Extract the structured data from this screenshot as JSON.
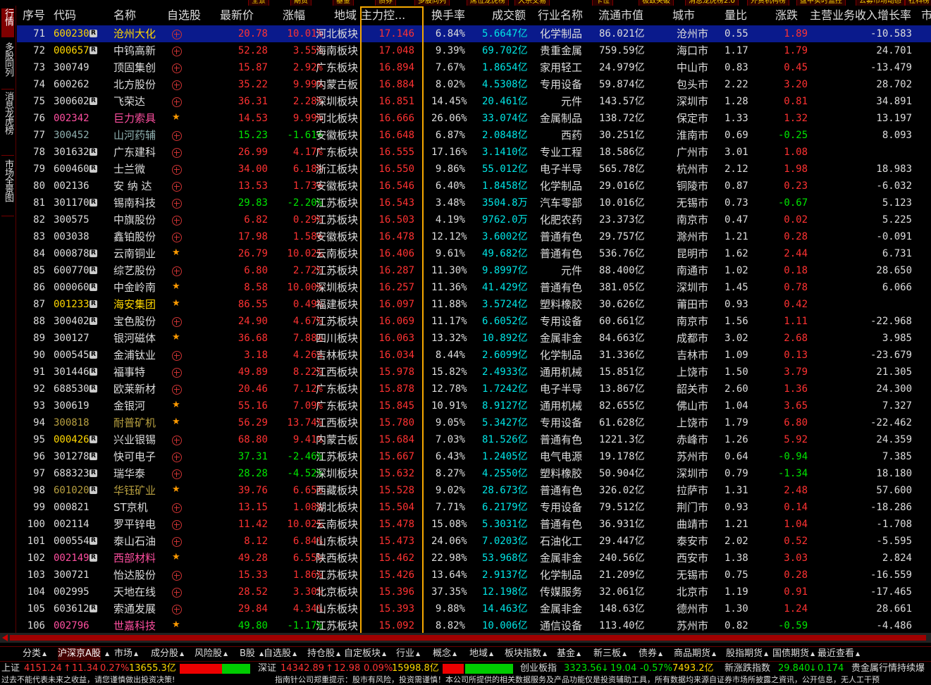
{
  "top_tabs": [
    "全景",
    "期货",
    "基金",
    "债券",
    "多股同列",
    "席位龙虎榜",
    "大宗交易",
    "卡位",
    "极致突破",
    "消息龙虎榜2.0",
    "外资机构榜",
    "盘中实时监控",
    "公募市场动态",
    "社科榜"
  ],
  "sidebar": [
    "行情",
    "多股同列",
    "消息龙虎榜2.0",
    "市场全景图"
  ],
  "columns": [
    "序号",
    "代码",
    "名称",
    "自选股",
    "最新价",
    "涨幅",
    "地域",
    "主力控...",
    "换手率",
    "成交额",
    "行业名称",
    "流通市值",
    "城市",
    "量比",
    "涨跌",
    "主营业务收入增长率",
    "市"
  ],
  "rows": [
    {
      "no": "71",
      "code": "600230",
      "name": "沧州大化",
      "r": true,
      "star": false,
      "price": "20.78",
      "pct": "10.01%",
      "region": "河北板块",
      "ctrl": "17.146",
      "turn": "6.84%",
      "amt": "5.6647亿",
      "ind": "化学制品",
      "mcap": "86.021亿",
      "city": "沧州市",
      "vr": "0.55",
      "chg": "1.89",
      "growth": "-10.583",
      "sel": true,
      "cc": "y",
      "nc": "y",
      "dir": "r"
    },
    {
      "no": "72",
      "code": "000657",
      "name": "中钨高新",
      "r": true,
      "star": false,
      "price": "52.28",
      "pct": "3.55%",
      "region": "海南板块",
      "ctrl": "17.048",
      "turn": "9.39%",
      "amt": "69.702亿",
      "ind": "贵重金属",
      "mcap": "759.59亿",
      "city": "海口市",
      "vr": "1.17",
      "chg": "1.79",
      "growth": "24.701",
      "cc": "y",
      "nc": "w",
      "dir": "r"
    },
    {
      "no": "73",
      "code": "300749",
      "name": "顶固集创",
      "r": false,
      "star": false,
      "price": "15.87",
      "pct": "2.92%",
      "region": "广东板块",
      "ctrl": "16.894",
      "turn": "7.67%",
      "amt": "1.8654亿",
      "ind": "家用轻工",
      "mcap": "24.979亿",
      "city": "中山市",
      "vr": "0.83",
      "chg": "0.45",
      "growth": "-13.479",
      "cc": "w",
      "nc": "w",
      "dir": "r"
    },
    {
      "no": "74",
      "code": "600262",
      "name": "北方股份",
      "r": false,
      "star": false,
      "price": "35.22",
      "pct": "9.99%",
      "region": "内蒙古板",
      "ctrl": "16.884",
      "turn": "8.02%",
      "amt": "4.5308亿",
      "ind": "专用设备",
      "mcap": "59.874亿",
      "city": "包头市",
      "vr": "2.22",
      "chg": "3.20",
      "growth": "28.702",
      "cc": "w",
      "nc": "w",
      "dir": "r"
    },
    {
      "no": "75",
      "code": "300602",
      "name": "飞荣达",
      "r": true,
      "star": false,
      "price": "36.31",
      "pct": "2.28%",
      "region": "深圳板块",
      "ctrl": "16.851",
      "turn": "14.45%",
      "amt": "20.461亿",
      "ind": "元件",
      "mcap": "143.57亿",
      "city": "深圳市",
      "vr": "1.28",
      "chg": "0.81",
      "growth": "34.891",
      "cc": "w",
      "nc": "w",
      "dir": "r"
    },
    {
      "no": "76",
      "code": "002342",
      "name": "巨力索具",
      "r": false,
      "star": true,
      "price": "14.53",
      "pct": "9.99%",
      "region": "河北板块",
      "ctrl": "16.666",
      "turn": "26.06%",
      "amt": "33.074亿",
      "ind": "金属制品",
      "mcap": "138.72亿",
      "city": "保定市",
      "vr": "1.33",
      "chg": "1.32",
      "growth": "13.197",
      "cc": "m",
      "nc": "m",
      "dir": "r"
    },
    {
      "no": "77",
      "code": "300452",
      "name": "山河药辅",
      "r": false,
      "star": false,
      "price": "15.23",
      "pct": "-1.61%",
      "region": "安徽板块",
      "ctrl": "16.648",
      "turn": "6.87%",
      "amt": "2.0848亿",
      "ind": "西药",
      "mcap": "30.251亿",
      "city": "淮南市",
      "vr": "0.69",
      "chg": "-0.25",
      "growth": "8.093",
      "cc": "gr",
      "nc": "gr",
      "dir": "g"
    },
    {
      "no": "78",
      "code": "301632",
      "name": "广东建科",
      "r": true,
      "star": false,
      "price": "26.99",
      "pct": "4.17%",
      "region": "广东板块",
      "ctrl": "16.555",
      "turn": "17.16%",
      "amt": "3.1410亿",
      "ind": "专业工程",
      "mcap": "18.586亿",
      "city": "广州市",
      "vr": "3.01",
      "chg": "1.08",
      "growth": "",
      "cc": "w",
      "nc": "w",
      "dir": "r"
    },
    {
      "no": "79",
      "code": "600460",
      "name": "士兰微",
      "r": true,
      "star": false,
      "price": "34.00",
      "pct": "6.18%",
      "region": "浙江板块",
      "ctrl": "16.550",
      "turn": "9.86%",
      "amt": "55.012亿",
      "ind": "电子半导",
      "mcap": "565.78亿",
      "city": "杭州市",
      "vr": "2.12",
      "chg": "1.98",
      "growth": "18.983",
      "cc": "w",
      "nc": "w",
      "dir": "r"
    },
    {
      "no": "80",
      "code": "002136",
      "name": "安 纳 达",
      "r": false,
      "star": false,
      "price": "13.53",
      "pct": "1.73%",
      "region": "安徽板块",
      "ctrl": "16.546",
      "turn": "6.40%",
      "amt": "1.8458亿",
      "ind": "化学制品",
      "mcap": "29.016亿",
      "city": "铜陵市",
      "vr": "0.87",
      "chg": "0.23",
      "growth": "-6.032",
      "cc": "w",
      "nc": "w",
      "dir": "r"
    },
    {
      "no": "81",
      "code": "301170",
      "name": "锡南科技",
      "r": true,
      "star": false,
      "price": "29.83",
      "pct": "-2.20%",
      "region": "江苏板块",
      "ctrl": "16.543",
      "turn": "3.48%",
      "amt": "3504.8万",
      "ind": "汽车零部",
      "mcap": "10.016亿",
      "city": "无锡市",
      "vr": "0.73",
      "chg": "-0.67",
      "growth": "5.123",
      "cc": "w",
      "nc": "w",
      "dir": "g"
    },
    {
      "no": "82",
      "code": "300575",
      "name": "中旗股份",
      "r": false,
      "star": false,
      "price": "6.82",
      "pct": "0.29%",
      "region": "江苏板块",
      "ctrl": "16.503",
      "turn": "4.19%",
      "amt": "9762.0万",
      "ind": "化肥农药",
      "mcap": "23.373亿",
      "city": "南京市",
      "vr": "0.47",
      "chg": "0.02",
      "growth": "5.225",
      "cc": "w",
      "nc": "w",
      "dir": "r"
    },
    {
      "no": "83",
      "code": "003038",
      "name": "鑫铂股份",
      "r": false,
      "star": false,
      "price": "17.98",
      "pct": "1.58%",
      "region": "安徽板块",
      "ctrl": "16.478",
      "turn": "12.12%",
      "amt": "3.6002亿",
      "ind": "普通有色",
      "mcap": "29.757亿",
      "city": "滁州市",
      "vr": "1.21",
      "chg": "0.28",
      "growth": "-0.091",
      "cc": "w",
      "nc": "w",
      "dir": "r"
    },
    {
      "no": "84",
      "code": "000878",
      "name": "云南铜业",
      "r": true,
      "star": true,
      "price": "26.79",
      "pct": "10.02%",
      "region": "云南板块",
      "ctrl": "16.406",
      "turn": "9.61%",
      "amt": "49.682亿",
      "ind": "普通有色",
      "mcap": "536.76亿",
      "city": "昆明市",
      "vr": "1.62",
      "chg": "2.44",
      "growth": "6.731",
      "cc": "w",
      "nc": "w",
      "dir": "r"
    },
    {
      "no": "85",
      "code": "600770",
      "name": "综艺股份",
      "r": true,
      "star": false,
      "price": "6.80",
      "pct": "2.72%",
      "region": "江苏板块",
      "ctrl": "16.287",
      "turn": "11.30%",
      "amt": "9.8997亿",
      "ind": "元件",
      "mcap": "88.400亿",
      "city": "南通市",
      "vr": "1.02",
      "chg": "0.18",
      "growth": "28.650",
      "cc": "w",
      "nc": "w",
      "dir": "r"
    },
    {
      "no": "86",
      "code": "000060",
      "name": "中金岭南",
      "r": true,
      "star": true,
      "price": "8.58",
      "pct": "10.00%",
      "region": "深圳板块",
      "ctrl": "16.257",
      "turn": "11.36%",
      "amt": "41.429亿",
      "ind": "普通有色",
      "mcap": "381.05亿",
      "city": "深圳市",
      "vr": "1.45",
      "chg": "0.78",
      "growth": "6.066",
      "cc": "w",
      "nc": "w",
      "dir": "r"
    },
    {
      "no": "87",
      "code": "001233",
      "name": "海安集团",
      "r": true,
      "star": true,
      "price": "86.55",
      "pct": "0.49%",
      "region": "福建板块",
      "ctrl": "16.097",
      "turn": "11.88%",
      "amt": "3.5724亿",
      "ind": "塑料橡胶",
      "mcap": "30.626亿",
      "city": "莆田市",
      "vr": "0.93",
      "chg": "0.42",
      "growth": "",
      "cc": "y",
      "nc": "y",
      "dir": "r"
    },
    {
      "no": "88",
      "code": "300402",
      "name": "宝色股份",
      "r": true,
      "star": false,
      "price": "24.90",
      "pct": "4.67%",
      "region": "江苏板块",
      "ctrl": "16.069",
      "turn": "11.17%",
      "amt": "6.6052亿",
      "ind": "专用设备",
      "mcap": "60.661亿",
      "city": "南京市",
      "vr": "1.56",
      "chg": "1.11",
      "growth": "-22.968",
      "cc": "w",
      "nc": "w",
      "dir": "r"
    },
    {
      "no": "89",
      "code": "300127",
      "name": "银河磁体",
      "r": false,
      "star": true,
      "price": "36.68",
      "pct": "7.88%",
      "region": "四川板块",
      "ctrl": "16.063",
      "turn": "13.32%",
      "amt": "10.892亿",
      "ind": "金属非金",
      "mcap": "84.663亿",
      "city": "成都市",
      "vr": "3.02",
      "chg": "2.68",
      "growth": "3.985",
      "cc": "w",
      "nc": "w",
      "dir": "r"
    },
    {
      "no": "90",
      "code": "000545",
      "name": "金浦钛业",
      "r": true,
      "star": false,
      "price": "3.18",
      "pct": "4.26%",
      "region": "吉林板块",
      "ctrl": "16.034",
      "turn": "8.44%",
      "amt": "2.6099亿",
      "ind": "化学制品",
      "mcap": "31.336亿",
      "city": "吉林市",
      "vr": "1.09",
      "chg": "0.13",
      "growth": "-23.679",
      "cc": "w",
      "nc": "w",
      "dir": "r"
    },
    {
      "no": "91",
      "code": "301446",
      "name": "福事特",
      "r": true,
      "star": false,
      "price": "49.89",
      "pct": "8.22%",
      "region": "江西板块",
      "ctrl": "15.978",
      "turn": "15.82%",
      "amt": "2.4933亿",
      "ind": "通用机械",
      "mcap": "15.851亿",
      "city": "上饶市",
      "vr": "1.50",
      "chg": "3.79",
      "growth": "21.305",
      "cc": "w",
      "nc": "w",
      "dir": "r"
    },
    {
      "no": "92",
      "code": "688530",
      "name": "欧莱新材",
      "r": true,
      "star": false,
      "price": "20.46",
      "pct": "7.12%",
      "region": "广东板块",
      "ctrl": "15.878",
      "turn": "12.78%",
      "amt": "1.7242亿",
      "ind": "电子半导",
      "mcap": "13.867亿",
      "city": "韶关市",
      "vr": "2.60",
      "chg": "1.36",
      "growth": "24.300",
      "cc": "w",
      "nc": "w",
      "dir": "r"
    },
    {
      "no": "93",
      "code": "300619",
      "name": "金银河",
      "r": false,
      "star": true,
      "price": "55.16",
      "pct": "7.09%",
      "region": "广东板块",
      "ctrl": "15.845",
      "turn": "10.91%",
      "amt": "8.9127亿",
      "ind": "通用机械",
      "mcap": "82.655亿",
      "city": "佛山市",
      "vr": "1.04",
      "chg": "3.65",
      "growth": "7.327",
      "cc": "w",
      "nc": "w",
      "dir": "r"
    },
    {
      "no": "94",
      "code": "300818",
      "name": "耐普矿机",
      "r": false,
      "star": true,
      "price": "56.29",
      "pct": "13.74%",
      "region": "江西板块",
      "ctrl": "15.780",
      "turn": "9.05%",
      "amt": "5.3427亿",
      "ind": "专用设备",
      "mcap": "61.628亿",
      "city": "上饶市",
      "vr": "1.79",
      "chg": "6.80",
      "growth": "-22.462",
      "cc": "ol",
      "nc": "ol",
      "dir": "r"
    },
    {
      "no": "95",
      "code": "000426",
      "name": "兴业银锡",
      "r": true,
      "star": false,
      "price": "68.80",
      "pct": "9.41%",
      "region": "内蒙古板",
      "ctrl": "15.684",
      "turn": "7.03%",
      "amt": "81.526亿",
      "ind": "普通有色",
      "mcap": "1221.3亿",
      "city": "赤峰市",
      "vr": "1.26",
      "chg": "5.92",
      "growth": "24.359",
      "cc": "y",
      "nc": "w",
      "dir": "r"
    },
    {
      "no": "96",
      "code": "301278",
      "name": "快可电子",
      "r": true,
      "star": false,
      "price": "37.31",
      "pct": "-2.46%",
      "region": "江苏板块",
      "ctrl": "15.667",
      "turn": "6.43%",
      "amt": "1.2405亿",
      "ind": "电气电源",
      "mcap": "19.178亿",
      "city": "苏州市",
      "vr": "0.64",
      "chg": "-0.94",
      "growth": "7.385",
      "cc": "w",
      "nc": "w",
      "dir": "g"
    },
    {
      "no": "97",
      "code": "688323",
      "name": "瑞华泰",
      "r": true,
      "star": false,
      "price": "28.28",
      "pct": "-4.52%",
      "region": "深圳板块",
      "ctrl": "15.632",
      "turn": "8.27%",
      "amt": "4.2550亿",
      "ind": "塑料橡胶",
      "mcap": "50.904亿",
      "city": "深圳市",
      "vr": "0.79",
      "chg": "-1.34",
      "growth": "18.180",
      "cc": "w",
      "nc": "w",
      "dir": "g"
    },
    {
      "no": "98",
      "code": "601020",
      "name": "华钰矿业",
      "r": true,
      "star": true,
      "price": "39.76",
      "pct": "6.65%",
      "region": "西藏板块",
      "ctrl": "15.528",
      "turn": "9.02%",
      "amt": "28.673亿",
      "ind": "普通有色",
      "mcap": "326.02亿",
      "city": "拉萨市",
      "vr": "1.31",
      "chg": "2.48",
      "growth": "57.600",
      "cc": "ol",
      "nc": "ol",
      "dir": "r"
    },
    {
      "no": "99",
      "code": "000821",
      "name": "ST京机",
      "r": false,
      "star": false,
      "price": "13.15",
      "pct": "1.08%",
      "region": "湖北板块",
      "ctrl": "15.504",
      "turn": "7.71%",
      "amt": "6.2179亿",
      "ind": "专用设备",
      "mcap": "79.512亿",
      "city": "荆门市",
      "vr": "0.93",
      "chg": "0.14",
      "growth": "-18.286",
      "cc": "w",
      "nc": "w",
      "dir": "r"
    },
    {
      "no": "100",
      "code": "002114",
      "name": "罗平锌电",
      "r": false,
      "star": false,
      "price": "11.42",
      "pct": "10.02%",
      "region": "云南板块",
      "ctrl": "15.478",
      "turn": "15.08%",
      "amt": "5.3031亿",
      "ind": "普通有色",
      "mcap": "36.931亿",
      "city": "曲靖市",
      "vr": "1.21",
      "chg": "1.04",
      "growth": "-1.708",
      "cc": "w",
      "nc": "w",
      "dir": "r"
    },
    {
      "no": "101",
      "code": "000554",
      "name": "泰山石油",
      "r": true,
      "star": false,
      "price": "8.12",
      "pct": "6.84%",
      "region": "山东板块",
      "ctrl": "15.473",
      "turn": "24.06%",
      "amt": "7.0203亿",
      "ind": "石油化工",
      "mcap": "29.447亿",
      "city": "泰安市",
      "vr": "2.02",
      "chg": "0.52",
      "growth": "-5.595",
      "cc": "w",
      "nc": "w",
      "dir": "r"
    },
    {
      "no": "102",
      "code": "002149",
      "name": "西部材料",
      "r": true,
      "star": true,
      "price": "49.28",
      "pct": "6.55%",
      "region": "陕西板块",
      "ctrl": "15.462",
      "turn": "22.98%",
      "amt": "53.968亿",
      "ind": "金属非金",
      "mcap": "240.56亿",
      "city": "西安市",
      "vr": "1.38",
      "chg": "3.03",
      "growth": "2.824",
      "cc": "m",
      "nc": "m",
      "dir": "r"
    },
    {
      "no": "103",
      "code": "300721",
      "name": "怡达股份",
      "r": false,
      "star": false,
      "price": "15.33",
      "pct": "1.86%",
      "region": "江苏板块",
      "ctrl": "15.426",
      "turn": "13.64%",
      "amt": "2.9137亿",
      "ind": "化学制品",
      "mcap": "21.209亿",
      "city": "无锡市",
      "vr": "0.75",
      "chg": "0.28",
      "growth": "-16.559",
      "cc": "w",
      "nc": "w",
      "dir": "r"
    },
    {
      "no": "104",
      "code": "002995",
      "name": "天地在线",
      "r": false,
      "star": false,
      "price": "28.52",
      "pct": "3.30%",
      "region": "北京板块",
      "ctrl": "15.396",
      "turn": "37.35%",
      "amt": "12.198亿",
      "ind": "传媒服务",
      "mcap": "32.061亿",
      "city": "北京市",
      "vr": "1.19",
      "chg": "0.91",
      "growth": "-17.465",
      "cc": "w",
      "nc": "w",
      "dir": "r"
    },
    {
      "no": "105",
      "code": "603612",
      "name": "索通发展",
      "r": true,
      "star": false,
      "price": "29.84",
      "pct": "4.34%",
      "region": "山东板块",
      "ctrl": "15.393",
      "turn": "9.88%",
      "amt": "14.463亿",
      "ind": "金属非金",
      "mcap": "148.63亿",
      "city": "德州市",
      "vr": "1.30",
      "chg": "1.24",
      "growth": "28.661",
      "cc": "w",
      "nc": "w",
      "dir": "r"
    },
    {
      "no": "106",
      "code": "002796",
      "name": "世嘉科技",
      "r": false,
      "star": true,
      "price": "49.80",
      "pct": "-1.17%",
      "region": "江苏板块",
      "ctrl": "15.092",
      "turn": "8.82%",
      "amt": "10.006亿",
      "ind": "通信设备",
      "mcap": "113.40亿",
      "city": "苏州市",
      "vr": "0.82",
      "chg": "-0.59",
      "growth": "-4.486",
      "cc": "m",
      "nc": "m",
      "dir": "g"
    }
  ],
  "bottom_tabs": [
    "分类",
    "沪深京A股",
    "市场",
    "成分股",
    "风险股",
    "B股",
    "自选股",
    "持仓股",
    "自定板块",
    "行业",
    "概念",
    "地域",
    "板块指数",
    "基金",
    "新三板",
    "债券",
    "商品期货",
    "股指期货",
    "国债期货",
    "最近查看"
  ],
  "status": {
    "sh_label": "上证",
    "sh_value": "4151.24",
    "sh_chg": "11.34",
    "sh_pct": "0.27%",
    "sh_amt": "13655.3亿",
    "sz_label": "深证",
    "sz_value": "14342.89",
    "sz_chg": "12.98",
    "sz_pct": "0.09%",
    "sz_amt": "15998.8亿",
    "cy_label": "创业板指",
    "cy_value": "3323.56",
    "cy_chg": "19.04",
    "cy_pct": "-0.57%",
    "cy_amt": "7493.2亿",
    "xz_label": "新涨跌指数",
    "xz_value": "29.840",
    "xz_chg": "0.174",
    "news": "贵金属行情持续爆"
  },
  "disclaimer_left": "过去不能代表未来之收益，请您谨慎做出投资决策!",
  "disclaimer_right": "指南针公司郑重提示：股市有风险，投资需谨慎！本公司所提供的相关数据服务及产品功能仅是投资辅助工具，所有数据均来源自证券市场所披露之資讯，公开信息，无人工干预"
}
